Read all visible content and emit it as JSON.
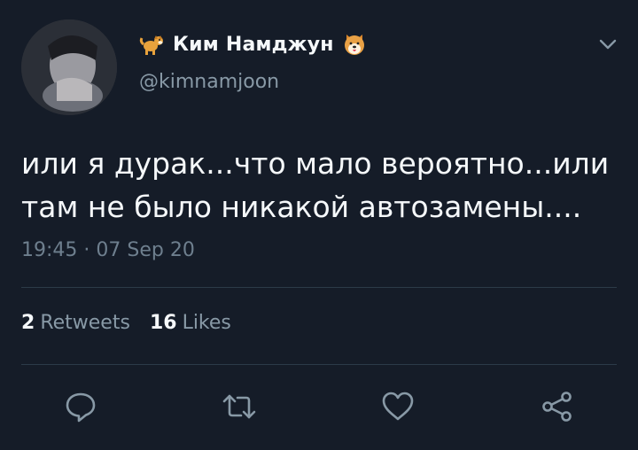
{
  "tweet": {
    "display_name": "Ким Намджун",
    "handle": "@kimnamjoon",
    "text": "или я дурак...что мало вероятно...или\nтам не было никакой автозамены....",
    "timestamp": "19:45 · 07 Sep 20",
    "retweets_count": "2",
    "retweets_label": "Retweets",
    "likes_count": "16",
    "likes_label": "Likes"
  },
  "icons": {
    "name_prefix_emoji": "dog-emoji-icon",
    "name_suffix_emoji": "dog-face-emoji-icon",
    "menu": "chevron-down-icon",
    "actions": [
      "reply-icon",
      "retweet-icon",
      "like-icon",
      "share-icon"
    ]
  },
  "colors": {
    "background": "#151c28",
    "text": "#f5f8fa",
    "muted": "#8899a6",
    "icon": "#8899a6",
    "divider": "#2c3a48"
  }
}
